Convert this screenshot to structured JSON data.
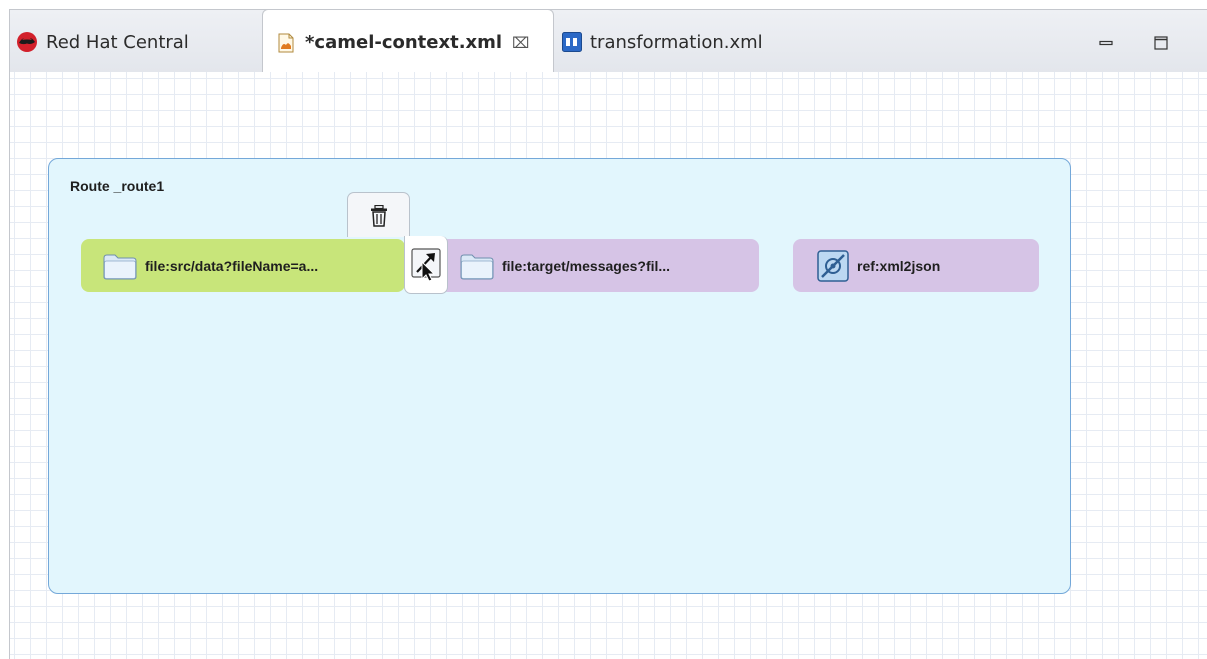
{
  "tabs": [
    {
      "label": "Red Hat Central",
      "icon": "redhat-icon",
      "active": false
    },
    {
      "label": "*camel-context.xml",
      "icon": "camel-xml-icon",
      "active": true,
      "close": "⌧"
    },
    {
      "label": "transformation.xml",
      "icon": "transformation-icon",
      "active": false
    }
  ],
  "window_controls": {
    "minimize": "minimize-icon",
    "maximize": "maximize-icon"
  },
  "route": {
    "title": "Route _route1"
  },
  "nodes": [
    {
      "label": "file:src/data?fileName=a...",
      "icon": "folder-icon",
      "color": "#c8e57a"
    },
    {
      "label": "file:target/messages?fil...",
      "icon": "folder-icon",
      "color": "#d6c4e6"
    },
    {
      "label": "ref:xml2json",
      "icon": "endpoint-icon",
      "color": "#d6c4e6"
    }
  ],
  "context_palette": {
    "delete": "trash-icon",
    "connect": "create-connection-icon"
  },
  "colors": {
    "route_fill": "#e2f6fd",
    "route_border": "#74a8d9",
    "grid": "#e6ebf3"
  }
}
